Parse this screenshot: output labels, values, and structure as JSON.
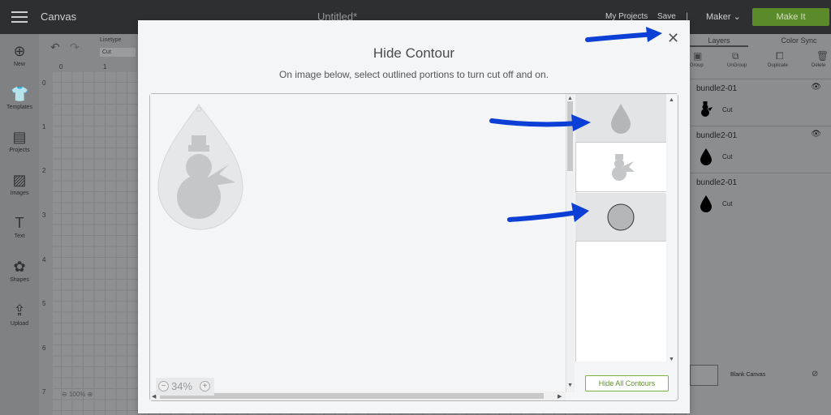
{
  "topbar": {
    "app_title": "Canvas",
    "doc_title": "Untitled*",
    "my_projects": "My Projects",
    "save": "Save",
    "separator": "|",
    "machine": "Maker",
    "make_it": "Make It"
  },
  "rail": {
    "items": [
      {
        "label": "New",
        "icon": "plus-circle-icon"
      },
      {
        "label": "Templates",
        "icon": "shirt-icon"
      },
      {
        "label": "Projects",
        "icon": "projects-icon"
      },
      {
        "label": "Images",
        "icon": "image-icon"
      },
      {
        "label": "Text",
        "icon": "text-icon"
      },
      {
        "label": "Shapes",
        "icon": "shapes-icon"
      },
      {
        "label": "Upload",
        "icon": "upload-icon"
      }
    ]
  },
  "toolbar": {
    "linetype_label": "Linetype",
    "linetype_value": "Cut"
  },
  "rulers": {
    "h": [
      "0",
      "1"
    ],
    "v": [
      "0",
      "1",
      "2",
      "3",
      "4",
      "5",
      "6",
      "7"
    ]
  },
  "canvas_zoom": "100%",
  "right_panel": {
    "tabs": [
      "Layers",
      "Color Sync"
    ],
    "actions": [
      "Group",
      "UnGroup",
      "Duplicate",
      "Delete"
    ],
    "layers": [
      {
        "name": "bundle2-01",
        "op": "Cut",
        "thumb": "snowman"
      },
      {
        "name": "bundle2-01",
        "op": "Cut",
        "thumb": "drop"
      },
      {
        "name": "bundle2-01",
        "op": "Cut",
        "thumb": "drop"
      }
    ],
    "blank_canvas": "Blank Canvas"
  },
  "modal": {
    "title": "Hide Contour",
    "subtitle": "On image below, select outlined portions to turn cut off and on.",
    "zoom": "34%",
    "contours": [
      {
        "shape": "drop",
        "selected": true
      },
      {
        "shape": "snowman",
        "selected": false
      },
      {
        "shape": "circle",
        "selected": true
      }
    ],
    "hide_all_label": "Hide All Contours"
  },
  "colors": {
    "accent_green": "#7cb342",
    "annotation_blue": "#0b3fd6",
    "topbar": "#2d2f31"
  }
}
